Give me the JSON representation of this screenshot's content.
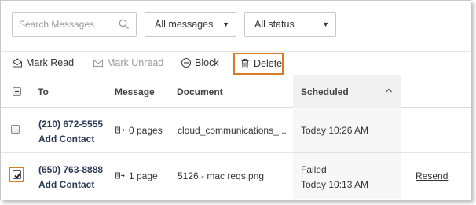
{
  "filters": {
    "search_placeholder": "Search Messages",
    "messages_select": "All messages",
    "status_select": "All status"
  },
  "toolbar": {
    "mark_read": "Mark Read",
    "mark_unread": "Mark Unread",
    "block": "Block",
    "delete": "Delete"
  },
  "table": {
    "headers": {
      "to": "To",
      "message": "Message",
      "document": "Document",
      "scheduled": "Scheduled"
    },
    "rows": [
      {
        "checked": false,
        "number": "(210) 672-5555",
        "contact_action": "Add Contact",
        "message": "0 pages",
        "document": "cloud_communications_...",
        "status": "",
        "scheduled": "Today 10:26 AM",
        "action": ""
      },
      {
        "checked": true,
        "number": "(650) 763-8888",
        "contact_action": "Add Contact",
        "message": "1 page",
        "document": "5126 - mac reqs.png",
        "status": "Failed",
        "scheduled": "Today 10:13 AM",
        "action": "Resend"
      }
    ]
  },
  "icons": {
    "search": "search-icon",
    "mark_read": "envelope-open-icon",
    "mark_unread": "envelope-icon",
    "block": "block-icon",
    "delete": "trash-icon",
    "sort": "chevron-up-icon",
    "pages": "fax-pages-icon"
  },
  "colors": {
    "highlight": "#d97a26",
    "contact_text": "#2b3a55",
    "disabled_text": "#9a9a9a"
  }
}
